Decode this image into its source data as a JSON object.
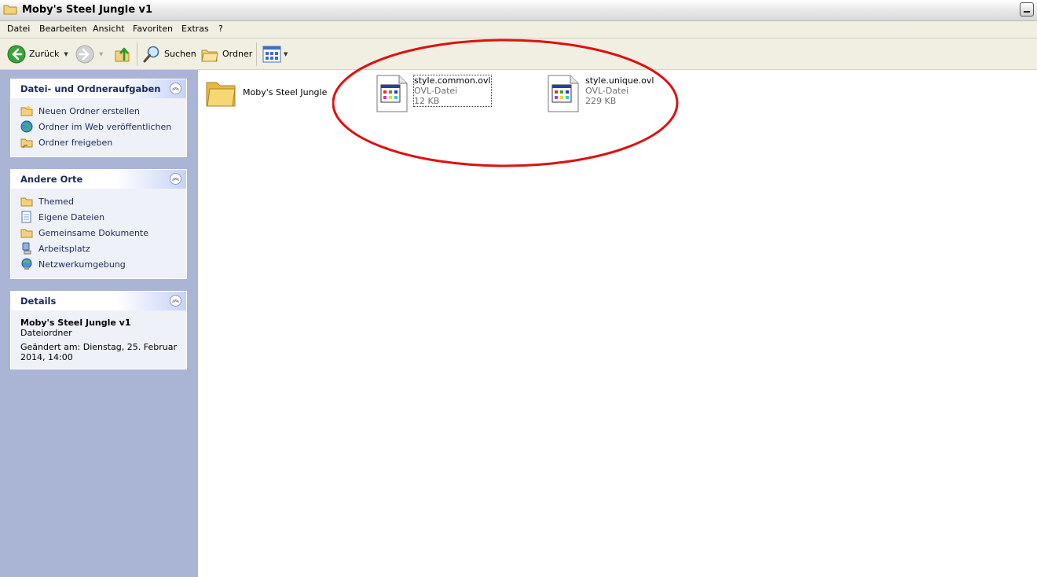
{
  "window": {
    "title": "Moby's Steel Jungle v1"
  },
  "menu": [
    "Datei",
    "Bearbeiten",
    "Ansicht",
    "Favoriten",
    "Extras",
    "?"
  ],
  "toolbar": {
    "back": "Zurück",
    "search": "Suchen",
    "folders": "Ordner"
  },
  "panels": {
    "tasks": {
      "title": "Datei- und Ordneraufgaben",
      "items": [
        "Neuen Ordner erstellen",
        "Ordner im Web veröffentlichen",
        "Ordner freigeben"
      ]
    },
    "places": {
      "title": "Andere Orte",
      "items": [
        "Themed",
        "Eigene Dateien",
        "Gemeinsame Dokumente",
        "Arbeitsplatz",
        "Netzwerkumgebung"
      ]
    },
    "details": {
      "title": "Details",
      "name": "Moby's Steel Jungle v1",
      "type": "Dateiordner",
      "modified_line1": "Geändert am: Dienstag, 25. Februar",
      "modified_line2": "2014, 14:00"
    }
  },
  "files": [
    {
      "name": "Moby's Steel Jungle",
      "kind": "folder"
    },
    {
      "name": "style.common.ovl",
      "type": "OVL-Datei",
      "size": "12 KB",
      "kind": "file",
      "selected": true
    },
    {
      "name": "style.unique.ovl",
      "type": "OVL-Datei",
      "size": "229 KB",
      "kind": "file"
    }
  ],
  "colors": {
    "annotation": "#e01010",
    "panel_title": "#1c2a5a",
    "leftpane": "#aab4d4"
  }
}
